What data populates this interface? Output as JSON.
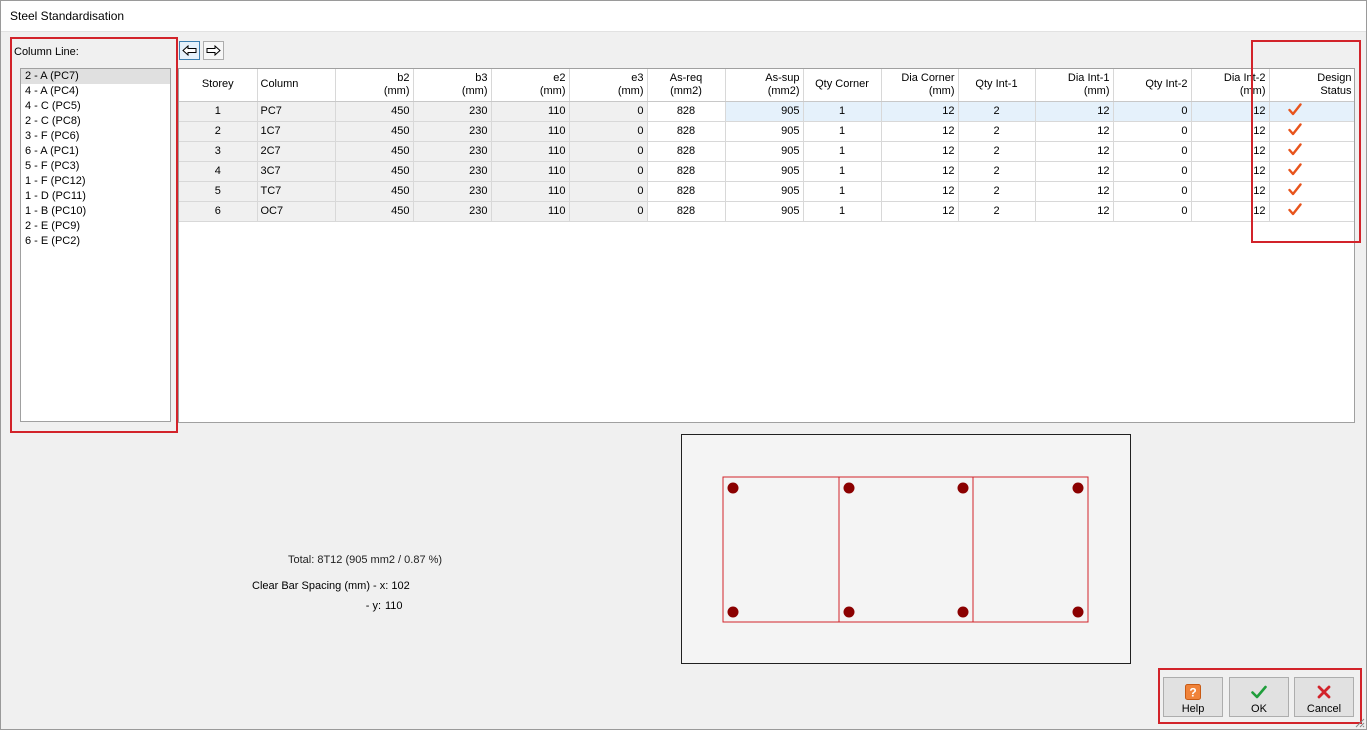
{
  "window": {
    "title": "Steel Standardisation"
  },
  "column_line": {
    "label": "Column Line:",
    "items": [
      "2 - A (PC7)",
      "4 - A (PC4)",
      "4 - C (PC5)",
      "2 - C (PC8)",
      "3 - F (PC6)",
      "6 - A (PC1)",
      "5 - F (PC3)",
      "1 - F (PC12)",
      "1 - D (PC11)",
      "1 - B (PC10)",
      "2 - E (PC9)",
      "6 - E (PC2)"
    ],
    "selected_index": 0
  },
  "nav": {
    "prev_icon": "arrow-left-icon",
    "next_icon": "arrow-right-icon"
  },
  "grid": {
    "headers": [
      "Storey",
      "Column",
      "b2\n(mm)",
      "b3\n(mm)",
      "e2\n(mm)",
      "e3\n(mm)",
      "As-req\n(mm2)",
      "As-sup\n(mm2)",
      "Qty Corner",
      "Dia Corner\n(mm)",
      "Qty Int-1",
      "Dia Int-1\n(mm)",
      "Qty Int-2",
      "Dia Int-2\n(mm)",
      "Design\nStatus"
    ],
    "rows": [
      [
        "1",
        "PC7",
        "450",
        "230",
        "110",
        "0",
        "828",
        "905",
        "1",
        "12",
        "2",
        "12",
        "0",
        "12"
      ],
      [
        "2",
        "1C7",
        "450",
        "230",
        "110",
        "0",
        "828",
        "905",
        "1",
        "12",
        "2",
        "12",
        "0",
        "12"
      ],
      [
        "3",
        "2C7",
        "450",
        "230",
        "110",
        "0",
        "828",
        "905",
        "1",
        "12",
        "2",
        "12",
        "0",
        "12"
      ],
      [
        "4",
        "3C7",
        "450",
        "230",
        "110",
        "0",
        "828",
        "905",
        "1",
        "12",
        "2",
        "12",
        "0",
        "12"
      ],
      [
        "5",
        "TC7",
        "450",
        "230",
        "110",
        "0",
        "828",
        "905",
        "1",
        "12",
        "2",
        "12",
        "0",
        "12"
      ],
      [
        "6",
        "OC7",
        "450",
        "230",
        "110",
        "0",
        "828",
        "905",
        "1",
        "12",
        "2",
        "12",
        "0",
        "12"
      ]
    ],
    "status_icon": "checkmark-icon",
    "status_color": "#e8541c"
  },
  "summary": {
    "total": "Total: 8T12  (905 mm2 / 0.87 %)",
    "spacing_label": "Clear Bar Spacing (mm) - x:",
    "spacing_x": "102",
    "spacing_y_label": "- y:",
    "spacing_y": "110"
  },
  "section": {
    "bar_color": "#8b0000",
    "outline_color": "#d2232a"
  },
  "buttons": {
    "help": {
      "label": "Help",
      "icon": "help-icon"
    },
    "ok": {
      "label": "OK",
      "icon": "check-icon"
    },
    "cancel": {
      "label": "Cancel",
      "icon": "close-icon"
    }
  },
  "highlight_color": "#d2232a"
}
